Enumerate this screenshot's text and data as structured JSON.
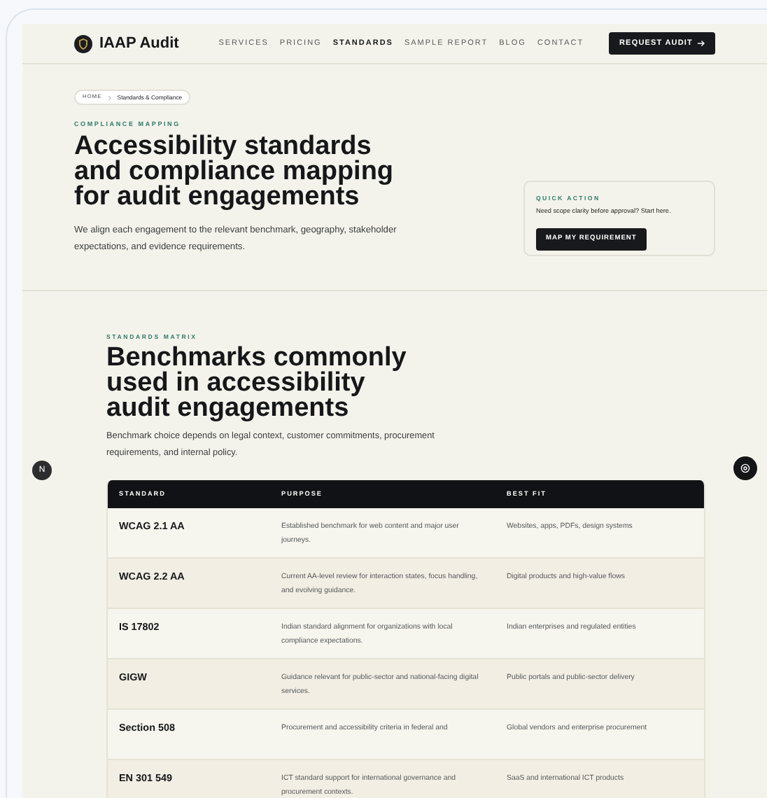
{
  "header": {
    "brand": "IAAP Audit",
    "nav": [
      {
        "label": "SERVICES",
        "selected": false
      },
      {
        "label": "PRICING",
        "selected": false
      },
      {
        "label": "STANDARDS",
        "selected": true
      },
      {
        "label": "SAMPLE REPORT",
        "selected": false
      },
      {
        "label": "BLOG",
        "selected": false
      },
      {
        "label": "CONTACT",
        "selected": false
      }
    ],
    "cta": "REQUEST AUDIT"
  },
  "hero": {
    "breadcrumb": [
      "HOME",
      "Standards & Compliance"
    ],
    "eyebrow": "COMPLIANCE MAPPING",
    "title": "Accessibility standards and compliance mapping for audit engagements",
    "text": "We align each engagement to the relevant benchmark, geography, stakeholder expectations, and evidence requirements.",
    "quick_action": {
      "label": "QUICK ACTION",
      "text": "Need scope clarity before approval? Start here.",
      "button": "MAP MY REQUIREMENT"
    }
  },
  "matrix": {
    "eyebrow": "STANDARDS MATRIX",
    "title": "Benchmarks commonly used in accessibility audit engagements",
    "text": "Benchmark choice depends on legal context, customer commitments, procurement requirements, and internal policy.",
    "table": {
      "columns": [
        "STANDARD",
        "PURPOSE",
        "BEST FIT"
      ],
      "rows": [
        [
          "WCAG 2.1 AA",
          "Established benchmark for web content and major user journeys.",
          "Websites, apps, PDFs, design systems"
        ],
        [
          "WCAG 2.2 AA",
          "Current AA-level review for interaction states, focus handling, and evolving guidance.",
          "Digital products and high-value flows"
        ],
        [
          "IS 17802",
          "Indian standard alignment for organizations with local compliance expectations.",
          "Indian enterprises and regulated entities"
        ],
        [
          "GIGW",
          "Guidance relevant for public-sector and national-facing digital services.",
          "Public portals and public-sector delivery"
        ],
        [
          "Section 508",
          "Procurement and accessibility criteria in federal and",
          "Global vendors and enterprise procurement"
        ],
        [
          "EN 301 549",
          "ICT standard support for international governance and procurement contexts.",
          "SaaS and international ICT products"
        ]
      ]
    }
  },
  "floating": {
    "left_badge": "N"
  }
}
